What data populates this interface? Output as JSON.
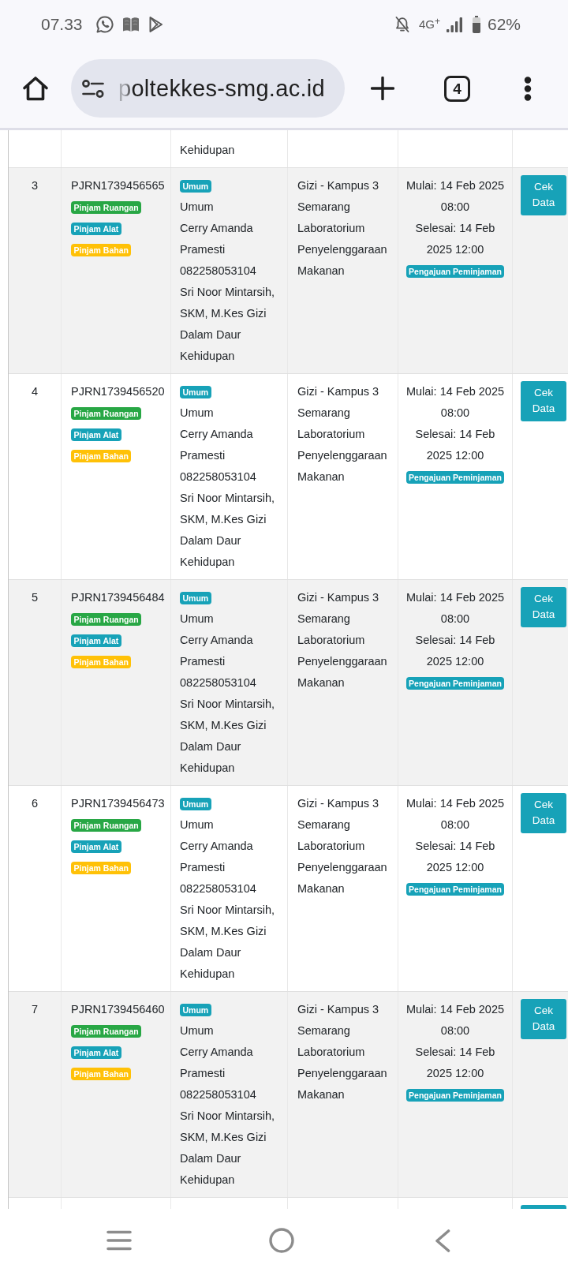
{
  "status_bar": {
    "time": "07.33",
    "network": "4G$^{+}$",
    "battery": "62%"
  },
  "browser": {
    "url": "poltekkes-smg.ac.id",
    "tab_count": "4"
  },
  "table": {
    "rows": [
      {
        "kind": "cut_top",
        "borrower": [
          "Kehidupan"
        ]
      },
      {
        "kind": "full",
        "number": "3",
        "code": "PJRN1739456565",
        "services": [
          {
            "label": "Pinjam Ruangan",
            "color": "#28a745"
          },
          {
            "label": "Pinjam Alat",
            "color": "#17a2b8"
          },
          {
            "label": "Pinjam Bahan",
            "color": "#ffc107"
          }
        ],
        "category": "Umum",
        "borrower": [
          "Umum",
          "Cerry Amanda Pramesti",
          "082258053104",
          "Sri Noor Mintarsih, SKM, M.Kes Gizi Dalam Daur Kehidupan"
        ],
        "location": [
          "Gizi - Kampus 3 Semarang",
          "Laboratorium Penyelenggaraan Makanan"
        ],
        "schedule": [
          "Mulai: 14 Feb 2025 08:00",
          "Selesai: 14 Feb 2025 12:00"
        ],
        "status": "Pengajuan Peminjaman",
        "action": "Cek Data"
      },
      {
        "kind": "full",
        "number": "4",
        "code": "PJRN1739456520",
        "services": [
          {
            "label": "Pinjam Ruangan",
            "color": "#28a745"
          },
          {
            "label": "Pinjam Alat",
            "color": "#17a2b8"
          },
          {
            "label": "Pinjam Bahan",
            "color": "#ffc107"
          }
        ],
        "category": "Umum",
        "borrower": [
          "Umum",
          "Cerry Amanda Pramesti",
          "082258053104",
          "Sri Noor Mintarsih, SKM, M.Kes Gizi Dalam Daur Kehidupan"
        ],
        "location": [
          "Gizi - Kampus 3 Semarang",
          "Laboratorium Penyelenggaraan Makanan"
        ],
        "schedule": [
          "Mulai: 14 Feb 2025 08:00",
          "Selesai: 14 Feb 2025 12:00"
        ],
        "status": "Pengajuan Peminjaman",
        "action": "Cek Data"
      },
      {
        "kind": "full",
        "number": "5",
        "code": "PJRN1739456484",
        "services": [
          {
            "label": "Pinjam Ruangan",
            "color": "#28a745"
          },
          {
            "label": "Pinjam Alat",
            "color": "#17a2b8"
          },
          {
            "label": "Pinjam Bahan",
            "color": "#ffc107"
          }
        ],
        "category": "Umum",
        "borrower": [
          "Umum",
          "Cerry Amanda Pramesti",
          "082258053104",
          "Sri Noor Mintarsih, SKM, M.Kes Gizi Dalam Daur Kehidupan"
        ],
        "location": [
          "Gizi - Kampus 3 Semarang",
          "Laboratorium Penyelenggaraan Makanan"
        ],
        "schedule": [
          "Mulai: 14 Feb 2025 08:00",
          "Selesai: 14 Feb 2025 12:00"
        ],
        "status": "Pengajuan Peminjaman",
        "action": "Cek Data"
      },
      {
        "kind": "full",
        "number": "6",
        "code": "PJRN1739456473",
        "services": [
          {
            "label": "Pinjam Ruangan",
            "color": "#28a745"
          },
          {
            "label": "Pinjam Alat",
            "color": "#17a2b8"
          },
          {
            "label": "Pinjam Bahan",
            "color": "#ffc107"
          }
        ],
        "category": "Umum",
        "borrower": [
          "Umum",
          "Cerry Amanda Pramesti",
          "082258053104",
          "Sri Noor Mintarsih, SKM, M.Kes Gizi Dalam Daur Kehidupan"
        ],
        "location": [
          "Gizi - Kampus 3 Semarang",
          "Laboratorium Penyelenggaraan Makanan"
        ],
        "schedule": [
          "Mulai: 14 Feb 2025 08:00",
          "Selesai: 14 Feb 2025 12:00"
        ],
        "status": "Pengajuan Peminjaman",
        "action": "Cek Data"
      },
      {
        "kind": "full",
        "number": "7",
        "code": "PJRN1739456460",
        "services": [
          {
            "label": "Pinjam Ruangan",
            "color": "#28a745"
          },
          {
            "label": "Pinjam Alat",
            "color": "#17a2b8"
          },
          {
            "label": "Pinjam Bahan",
            "color": "#ffc107"
          }
        ],
        "category": "Umum",
        "borrower": [
          "Umum",
          "Cerry Amanda Pramesti",
          "082258053104",
          "Sri Noor Mintarsih, SKM, M.Kes Gizi Dalam Daur Kehidupan"
        ],
        "location": [
          "Gizi - Kampus 3 Semarang",
          "Laboratorium Penyelenggaraan Makanan"
        ],
        "schedule": [
          "Mulai: 14 Feb 2025 08:00",
          "Selesai: 14 Feb 2025 12:00"
        ],
        "status": "Pengajuan Peminjaman",
        "action": "Cek Data"
      },
      {
        "kind": "cut_bottom"
      }
    ]
  }
}
